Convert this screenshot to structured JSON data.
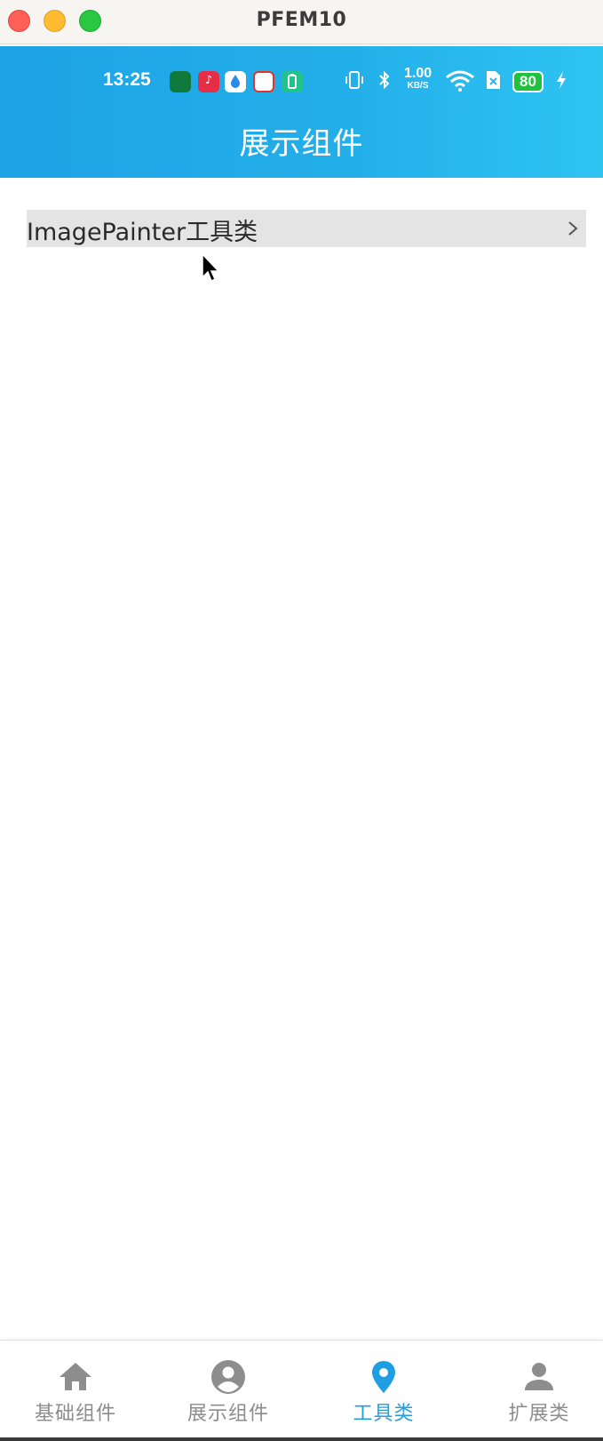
{
  "window": {
    "title": "PFEM10"
  },
  "status_bar": {
    "time": "13:25",
    "net_speed_value": "1.00",
    "net_speed_unit": "KB/S",
    "battery_level": "80",
    "icons": [
      "vibrate-icon",
      "bluetooth-icon",
      "wifi-icon",
      "sim-icon",
      "charging-icon"
    ]
  },
  "header": {
    "title": "展示组件"
  },
  "list": {
    "items": [
      {
        "label": "ImagePainter工具类"
      }
    ]
  },
  "tabbar": {
    "active_index": 2,
    "items": [
      {
        "label": "基础组件",
        "icon": "home-icon"
      },
      {
        "label": "展示组件",
        "icon": "account-circle-icon"
      },
      {
        "label": "工具类",
        "icon": "location-pin-icon"
      },
      {
        "label": "扩展类",
        "icon": "person-icon"
      }
    ]
  },
  "colors": {
    "header_start": "#1ea3e6",
    "header_end": "#2ec4f2",
    "active_tab": "#1f9ee3",
    "inactive_tab": "#8d8d8d",
    "list_row_bg": "#e4e4e4",
    "battery": "#1fc23d"
  }
}
